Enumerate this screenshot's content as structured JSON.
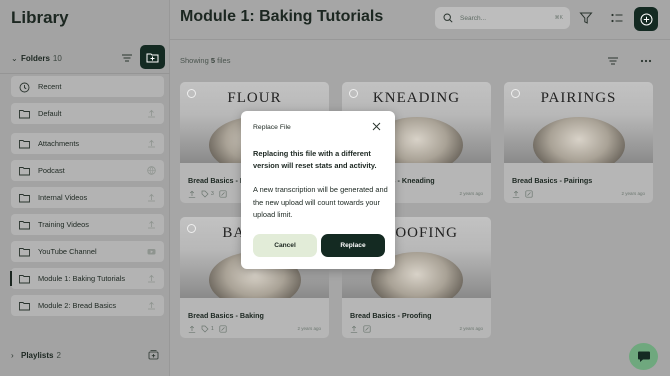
{
  "sidebar": {
    "title": "Library",
    "folders_label": "Folders",
    "folders_count": "10",
    "items": [
      {
        "label": "Recent"
      },
      {
        "label": "Default"
      },
      {
        "label": "Attachments"
      },
      {
        "label": "Podcast"
      },
      {
        "label": "Internal Videos"
      },
      {
        "label": "Training Videos"
      },
      {
        "label": "YouTube Channel"
      },
      {
        "label": "Module 1: Baking Tutorials"
      },
      {
        "label": "Module 2: Bread Basics"
      }
    ],
    "playlists_label": "Playlists",
    "playlists_count": "2"
  },
  "header": {
    "title": "Module 1: Baking Tutorials",
    "search_placeholder": "Search...",
    "search_shortcut": "⌘K"
  },
  "toolbar": {
    "showing_prefix": "Showing",
    "showing_count": "5",
    "showing_suffix": "files"
  },
  "cards": [
    {
      "word": "FLOUR",
      "title": "Bread Basics - Flour",
      "count": "3",
      "age": "2 years ago"
    },
    {
      "word": "KNEADING",
      "title": "Bread Basics - Kneading",
      "count": "",
      "age": "2 years ago"
    },
    {
      "word": "PAIRINGS",
      "title": "Bread Basics - Pairings",
      "count": "",
      "age": "2 years ago"
    },
    {
      "word": "BAKING",
      "title": "Bread Basics - Baking",
      "count": "1",
      "age": "2 years ago"
    },
    {
      "word": "PROOFING",
      "title": "Bread Basics - Proofing",
      "count": "",
      "age": "2 years ago"
    }
  ],
  "modal": {
    "title": "Replace File",
    "bold_message": "Replacing this file with a different version will reset stats and activity.",
    "message": "A new transcription will be generated and the new upload will count towards your upload limit.",
    "cancel_label": "Cancel",
    "replace_label": "Replace"
  },
  "colors": {
    "accent_dark": "#142a22",
    "cancel_bg": "#e2ecd8",
    "chat_fab": "#6fa87e"
  }
}
